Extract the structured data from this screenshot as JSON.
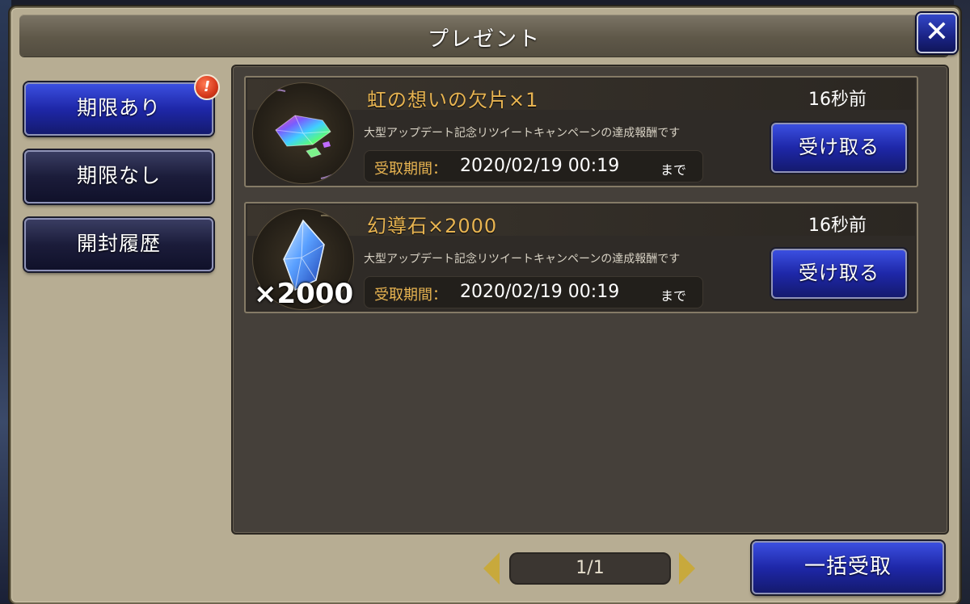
{
  "dialog": {
    "title": "プレゼント",
    "close_icon": "close-icon"
  },
  "sidebar": {
    "items": [
      {
        "label": "期限あり",
        "active": true,
        "badge": "!"
      },
      {
        "label": "期限なし",
        "active": false
      },
      {
        "label": "開封履歴",
        "active": false
      }
    ]
  },
  "presents": [
    {
      "name": "虹の想いの欠片×1",
      "time_ago": "16秒前",
      "description": "大型アップデート記念リツイートキャンペーンの達成報酬です",
      "period_label": "受取期間：",
      "period_date": "2020/02/19 00:19",
      "period_until": "まで",
      "receive_label": "受け取る",
      "icon": "rainbow-shard-icon",
      "quantity_overlay": ""
    },
    {
      "name": "幻導石×2000",
      "time_ago": "16秒前",
      "description": "大型アップデート記念リツイートキャンペーンの達成報酬です",
      "period_label": "受取期間：",
      "period_date": "2020/02/19 00:19",
      "period_until": "まで",
      "receive_label": "受け取る",
      "icon": "crystal-icon",
      "quantity_overlay": "×2000"
    }
  ],
  "pager": {
    "page": "1/1"
  },
  "bulk_receive_label": "一括受取",
  "colors": {
    "accent_blue": "#1e27a8",
    "gold_text": "#e8b451",
    "panel": "#b7ad93"
  }
}
